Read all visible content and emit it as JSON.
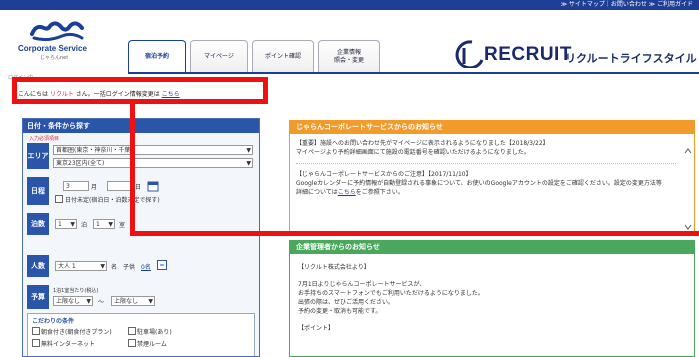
{
  "top_links": "≫ サイトマップ｜お問い合わせ ≫ ご利用ガイド",
  "logo": {
    "brand": "Corporate Service",
    "sub": "じゃらんnet"
  },
  "tabs": [
    {
      "label": "宿泊予約"
    },
    {
      "label": "マイページ"
    },
    {
      "label": "ポイント確認"
    },
    {
      "label": "企業情報\n照会・変更"
    }
  ],
  "recruit": {
    "word": "RECRUIT",
    "kana": "リクルートライフスタイル"
  },
  "greeting": {
    "small_label": "ログイン中",
    "prefix": "こんにちは",
    "user": "リクルト",
    "suffix": "さん。一括ログイン情報変更は",
    "link": "こちら"
  },
  "search": {
    "header": "日付・条件から探す",
    "area_hint": "入力必須項目",
    "labels": {
      "area": "エリア",
      "date": "日程",
      "nights": "泊数",
      "people": "人数",
      "budget": "予算"
    },
    "area_select_1": "首都圏(東京・神奈川・千葉)",
    "area_select_2": "東京23区内(全て)",
    "month": "3",
    "day": "",
    "month_unit": "月",
    "day_unit": "日",
    "undecided_label": "日付未定(宿泊日・泊数未定で探す)",
    "nights_value": "1",
    "nights_unit": "泊",
    "rooms_value": "1",
    "rooms_unit": "室",
    "adults_value": "大人 1",
    "adults_unit": "名",
    "child_label": "子供",
    "child_link": "0名",
    "budget_caption": "1泊1室当たり(税込)",
    "budget_min": "上限なし",
    "budget_sep": "〜",
    "budget_max": "上限なし",
    "more_header": "こだわりの条件",
    "opt_1": "朝食付き(朝食付きプラン)",
    "opt_2": "駐車場(あり)",
    "opt_3": "無料インターネット",
    "opt_4": "禁煙ルーム"
  },
  "notice": {
    "header": "じゃらんコーポレートサービスからのお知らせ",
    "item1_title": "【重要】施設へのお問い合わせ先がマイページに表示されるようになりました【2018/3/22】",
    "item1_body": "マイページより予約詳細画面にて施設の電話番号を確認いただけるようになりました。",
    "item2_title": "【じゃらんコーポレートサービスからのご注意】【2017/11/10】",
    "item2_body": "Googleカレンダーに予約情報が自動登録される事象について、お使いのGoogleアカウントの設定をご確認ください。設定の変更方法等",
    "item2_more": "詳細については",
    "item2_link": "こちら",
    "item2_end": "をご参照下さい。"
  },
  "company": {
    "header": "企業管理者からのお知らせ",
    "line1": "【リクルト株式会社より】",
    "line2": "7月1日よりじゃらんコーポレートサービスが、",
    "line3": "お手持ちのスマートフォンでもご利用いただけるようになりました。",
    "line4": "出張の際は、ぜひご活用ください。",
    "line5": "予約の変更・取消も可能です。",
    "line6": "【ポイント】"
  },
  "colors": {
    "brand_blue": "#1a3f9a",
    "orange": "#f39b2a",
    "green": "#49a85b",
    "highlight": "#ee1111"
  }
}
